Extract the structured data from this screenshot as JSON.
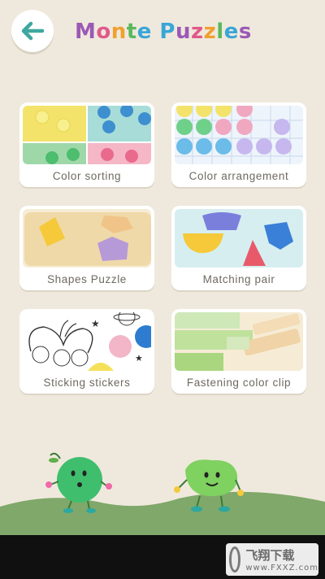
{
  "header": {
    "back_button_icon": "arrow-left-icon",
    "title_letters": [
      {
        "ch": "M",
        "color": "#9b59b6"
      },
      {
        "ch": "o",
        "color": "#e05a8a"
      },
      {
        "ch": "n",
        "color": "#f0a030"
      },
      {
        "ch": "t",
        "color": "#5bb85d"
      },
      {
        "ch": "e",
        "color": "#3aa6d8"
      },
      {
        "ch": " ",
        "color": "#000000"
      },
      {
        "ch": "P",
        "color": "#3aa6d8"
      },
      {
        "ch": "u",
        "color": "#9b59b6"
      },
      {
        "ch": "z",
        "color": "#e05a8a"
      },
      {
        "ch": "z",
        "color": "#f0a030"
      },
      {
        "ch": "l",
        "color": "#5bb85d"
      },
      {
        "ch": "e",
        "color": "#3aa6d8"
      },
      {
        "ch": "s",
        "color": "#9b59b6"
      }
    ]
  },
  "puzzles": [
    {
      "id": "color-sorting",
      "label": "Color sorting"
    },
    {
      "id": "color-arrangement",
      "label": "Color arrangement"
    },
    {
      "id": "shapes-puzzle",
      "label": "Shapes Puzzle"
    },
    {
      "id": "matching-pair",
      "label": "Matching pair"
    },
    {
      "id": "sticking-stickers",
      "label": "Sticking stickers"
    },
    {
      "id": "fastening-color-clip",
      "label": "Fastening color clip"
    }
  ],
  "colors": {
    "background": "#efe9dd",
    "card": "#ffffff",
    "label": "#6e6a60",
    "hill": "#7fa86a",
    "accent_teal": "#3fa7a0"
  },
  "watermark": {
    "title": "飞翔下载",
    "subtitle": "www.FXXZ.com"
  }
}
